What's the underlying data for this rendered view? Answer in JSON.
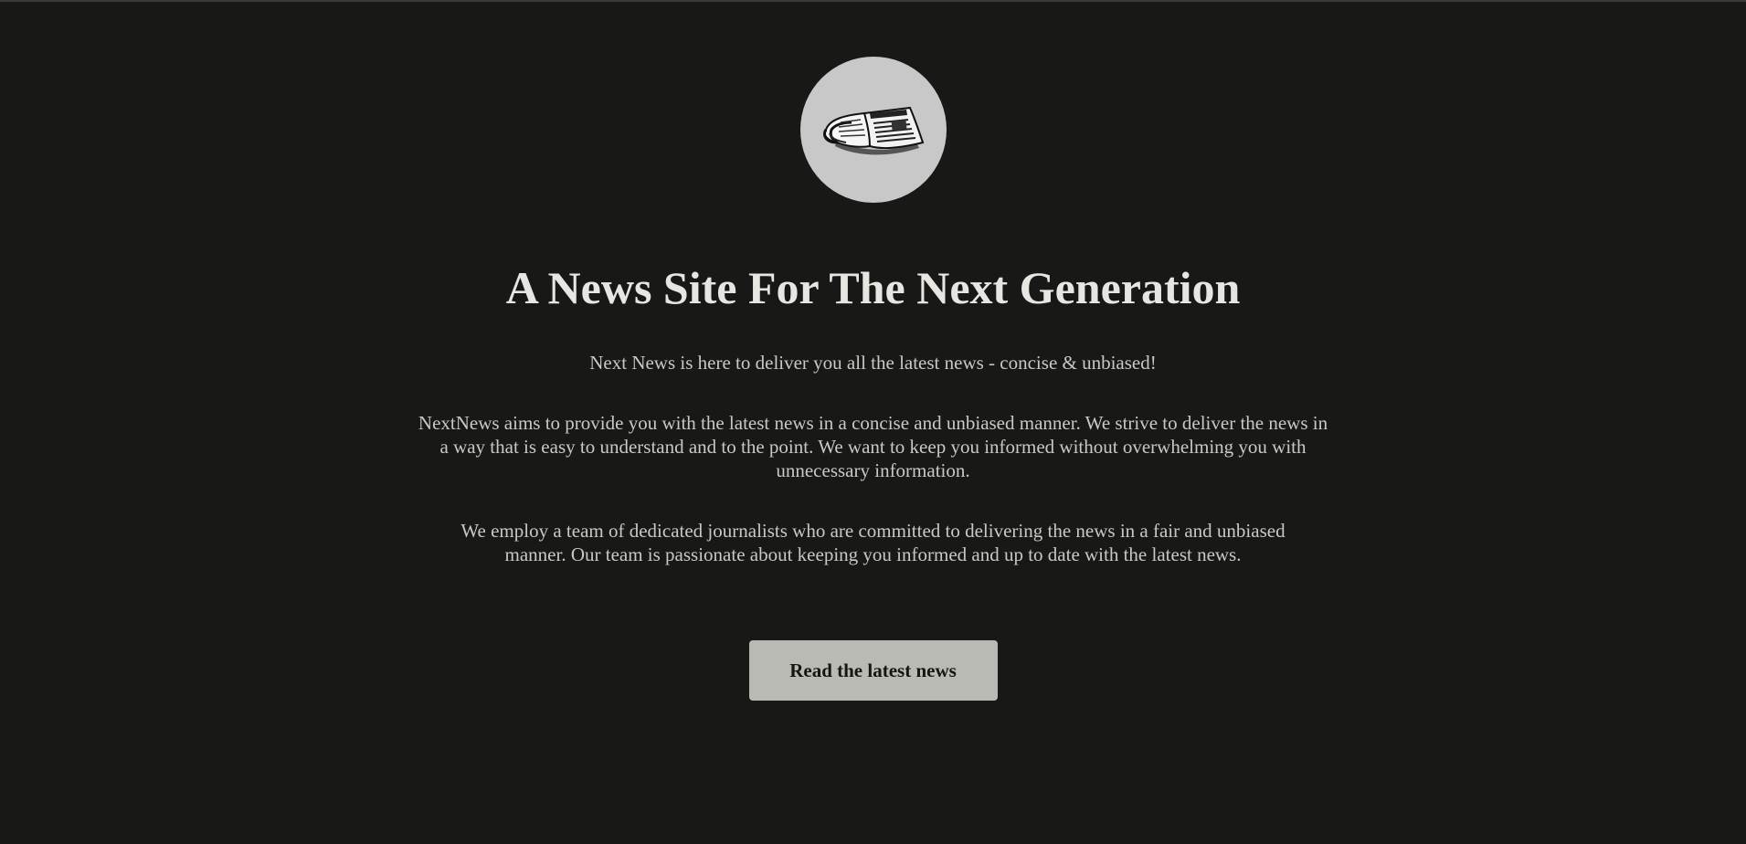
{
  "logo": {
    "icon": "newspaper-icon"
  },
  "hero": {
    "headline": "A News Site For The Next Generation",
    "tagline": "Next News is here to deliver you all the latest news - concise & unbiased!",
    "paragraph_1": "NextNews aims to provide you with the latest news in a concise and unbiased manner. We strive to deliver the news in a way that is easy to understand and to the point. We want to keep you informed without overwhelming you with unnecessary information.",
    "paragraph_2": "We employ a team of dedicated journalists who are committed to delivering the news in a fair and unbiased manner. Our team is passionate about keeping you informed and up to date with the latest news."
  },
  "cta": {
    "label": "Read the latest news"
  },
  "colors": {
    "background": "#181817",
    "logo_circle": "#c8c8c8",
    "headline": "#e8e6e1",
    "body_text": "#c9c9c4",
    "button_bg": "#b9bab4",
    "button_text": "#151515"
  }
}
